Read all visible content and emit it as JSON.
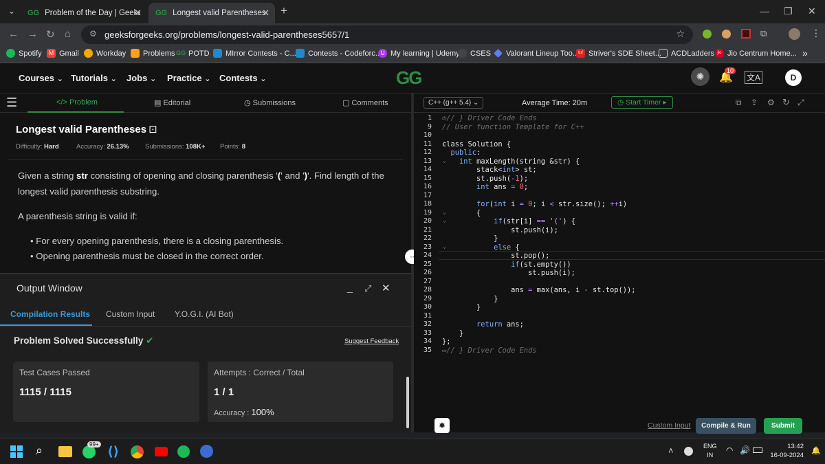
{
  "browser": {
    "tabs": [
      {
        "title": "Problem of the Day | GeeksforG",
        "favicon": "GG"
      },
      {
        "title": "Longest valid Parentheses | Prac",
        "favicon": "GG"
      }
    ],
    "new_tab": "+",
    "url": "geeksforgeeks.org/problems/longest-valid-parentheses5657/1",
    "bookmarks": [
      {
        "label": "Spotify",
        "color": "#1db954"
      },
      {
        "label": "Gmail",
        "color": "#ea4335"
      },
      {
        "label": "Workday",
        "color": "#f2a900"
      },
      {
        "label": "Problems",
        "color": "#ffa116"
      },
      {
        "label": "POTD",
        "color": "#2f8d46"
      },
      {
        "label": "MIrror Contests - C...",
        "color": "#1f8acb"
      },
      {
        "label": "Contests - Codeforc...",
        "color": "#1f8acb"
      },
      {
        "label": "My learning | Udemy",
        "color": "#a435f0"
      },
      {
        "label": "CSES",
        "color": "#444444"
      },
      {
        "label": "Valorant Lineup Too...",
        "color": "#5a7dff"
      },
      {
        "label": "Striver's SDE Sheet...",
        "color": "#e02020"
      },
      {
        "label": "ACDLadders",
        "color": "#555555"
      },
      {
        "label": "Jio Centrum Home...",
        "color": "#d6001c"
      }
    ],
    "bookmarks_more": "»"
  },
  "gfg_header": {
    "menus": [
      "Courses",
      "Tutorials",
      "Jobs",
      "Practice",
      "Contests"
    ],
    "logo": "GG",
    "notification_count": "10",
    "avatar_letter": "D"
  },
  "problem_tabs": [
    "Problem",
    "Editorial",
    "Submissions",
    "Comments"
  ],
  "problem": {
    "title": "Longest valid Parentheses",
    "difficulty_label": "Difficulty:",
    "difficulty": "Hard",
    "accuracy_label": "Accuracy:",
    "accuracy": "26.13%",
    "submissions_label": "Submissions:",
    "submissions": "108K+",
    "points_label": "Points:",
    "points": "8",
    "desc_parts": [
      "Given a string ",
      "str",
      " consisting of opening and closing parenthesis '",
      "(",
      "' and '",
      ")",
      "'. Find length of the longest valid parenthesis substring."
    ],
    "valid_intro": "A parenthesis string is valid if:",
    "bullets": [
      "For every opening parenthesis, there is a closing parenthesis.",
      "Opening parenthesis must be closed in the correct order."
    ]
  },
  "output_window": {
    "title": "Output Window",
    "tabs": [
      "Compilation Results",
      "Custom Input",
      "Y.O.G.I. (AI Bot)"
    ],
    "status": "Problem Solved Successfully",
    "feedback": "Suggest Feedback",
    "test_cases_label": "Test Cases Passed",
    "test_cases_value": "1115 / 1115",
    "attempts_label": "Attempts : Correct / Total",
    "attempts_value": "1 / 1",
    "accuracy_label": "Accuracy :",
    "accuracy_value": "100%"
  },
  "editor": {
    "language": "C++ (g++ 5.4)",
    "average_time": "Average Time: 20m",
    "start_timer": "Start Timer",
    "lines": [
      {
        "n": "1",
        "fold": "›",
        "html": "<span class='cm'>▭// } Driver Code Ends</span>"
      },
      {
        "n": "9",
        "fold": "",
        "html": "<span class='cm'>// User function Template for C++</span>"
      },
      {
        "n": "10",
        "fold": "",
        "html": ""
      },
      {
        "n": "11",
        "fold": "⌄",
        "html": "class Solution {"
      },
      {
        "n": "12",
        "fold": "",
        "html": "  <span class='kw'>public</span>:"
      },
      {
        "n": "13",
        "fold": "⌄",
        "html": "    <span class='kw'>int</span> maxLength(string &amp;str) {"
      },
      {
        "n": "14",
        "fold": "",
        "html": "        stack&lt;<span class='kw'>int</span>&gt; st;"
      },
      {
        "n": "15",
        "fold": "",
        "html": "        st.push(<span class='op'>-</span><span class='num'>1</span>);"
      },
      {
        "n": "16",
        "fold": "",
        "html": "        <span class='kw'>int</span> ans <span class='op'>=</span> <span class='num'>0</span>;"
      },
      {
        "n": "17",
        "fold": "",
        "html": ""
      },
      {
        "n": "18",
        "fold": "",
        "html": "        <span class='kw'>for</span>(<span class='kw'>int</span> i <span class='op'>=</span> <span class='num'>0</span>; i <span class='op'>&lt;</span> str.size(); <span class='op'>++</span>i)"
      },
      {
        "n": "19",
        "fold": "⌄",
        "html": "        {"
      },
      {
        "n": "20",
        "fold": "⌄",
        "html": "            <span class='kw'>if</span>(str[i] <span class='op'>==</span> <span class='str'>'('</span>) {"
      },
      {
        "n": "21",
        "fold": "",
        "html": "                st.push(i);"
      },
      {
        "n": "22",
        "fold": "",
        "html": "            }"
      },
      {
        "n": "23",
        "fold": "⌄",
        "html": "            <span class='kw'>else</span> {"
      },
      {
        "n": "24",
        "fold": "",
        "html": "                st.pop();"
      },
      {
        "n": "25",
        "fold": "",
        "html": "                <span class='kw'>if</span>(st.empty())"
      },
      {
        "n": "26",
        "fold": "",
        "html": "                    st.push(i);"
      },
      {
        "n": "27",
        "fold": "",
        "html": ""
      },
      {
        "n": "28",
        "fold": "",
        "html": "                ans <span class='op'>=</span> max(ans, i <span class='op'>-</span> st.top());"
      },
      {
        "n": "29",
        "fold": "",
        "html": "            }"
      },
      {
        "n": "30",
        "fold": "",
        "html": "        }"
      },
      {
        "n": "31",
        "fold": "",
        "html": ""
      },
      {
        "n": "32",
        "fold": "",
        "html": "        <span class='kw'>return</span> ans;"
      },
      {
        "n": "33",
        "fold": "",
        "html": "    }"
      },
      {
        "n": "34",
        "fold": "",
        "html": "};"
      },
      {
        "n": "35",
        "fold": "",
        "html": "<span class='cm'>▭// } Driver Code Ends</span>"
      }
    ],
    "custom_input": "Custom Input",
    "compile_run": "Compile & Run",
    "submit": "Submit"
  },
  "taskbar": {
    "lang_top": "ENG",
    "lang_bottom": "IN",
    "time": "13:42",
    "date": "16-09-2024",
    "whatsapp_badge": "99+"
  },
  "colors": {
    "accent_green": "#2f8d46",
    "submit_green": "#24a150",
    "success_green": "#2eaa52",
    "tab_blue": "#3b99d8"
  }
}
